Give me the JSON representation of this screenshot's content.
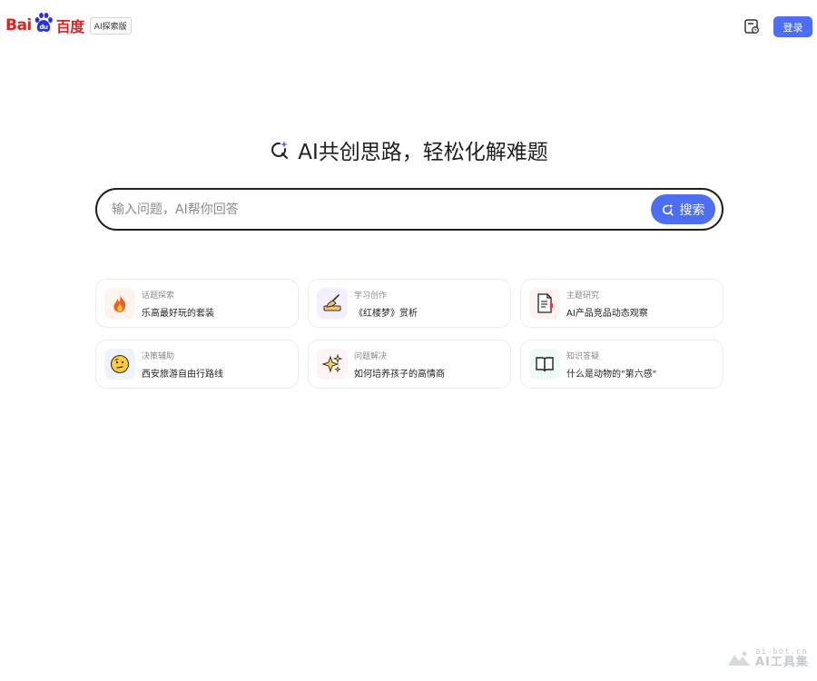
{
  "header": {
    "logo_bai": "Bai",
    "logo_du": "du",
    "logo_cn": "百度",
    "edition_badge": "AI探索版",
    "history_icon": "history-icon",
    "login_label": "登录",
    "accent_color": "#4e6ef2",
    "brand_color": "#e02020"
  },
  "hero": {
    "title": "AI共创思路，轻松化解难题",
    "icon": "ai-spark-icon"
  },
  "search": {
    "placeholder": "输入问题，AI帮你回答",
    "value": "",
    "button_label": "搜索",
    "button_icon": "ai-spark-icon"
  },
  "cards": [
    {
      "category": "话题探索",
      "question": "乐高最好玩的套装",
      "icon": "fire-icon",
      "icon_bg": "#fff4ec"
    },
    {
      "category": "学习创作",
      "question": "《红楼梦》赏析",
      "icon": "writing-hand-icon",
      "icon_bg": "#f3efff"
    },
    {
      "category": "主题研究",
      "question": "AI产品竞品动态观察",
      "icon": "document-icon",
      "icon_bg": "#fff3ef"
    },
    {
      "category": "决策辅助",
      "question": "西安旅游自由行路线",
      "icon": "thinking-face-icon",
      "icon_bg": "#eef4ff"
    },
    {
      "category": "问题解决",
      "question": "如何培养孩子的高情商",
      "icon": "sparkles-icon",
      "icon_bg": "#fff3f3"
    },
    {
      "category": "知识答疑",
      "question": "什么是动物的\"第六感\"",
      "icon": "open-book-icon",
      "icon_bg": "#eefaf6"
    }
  ],
  "watermark": {
    "url": "ai-bot.cn",
    "name": "AI工具集"
  }
}
